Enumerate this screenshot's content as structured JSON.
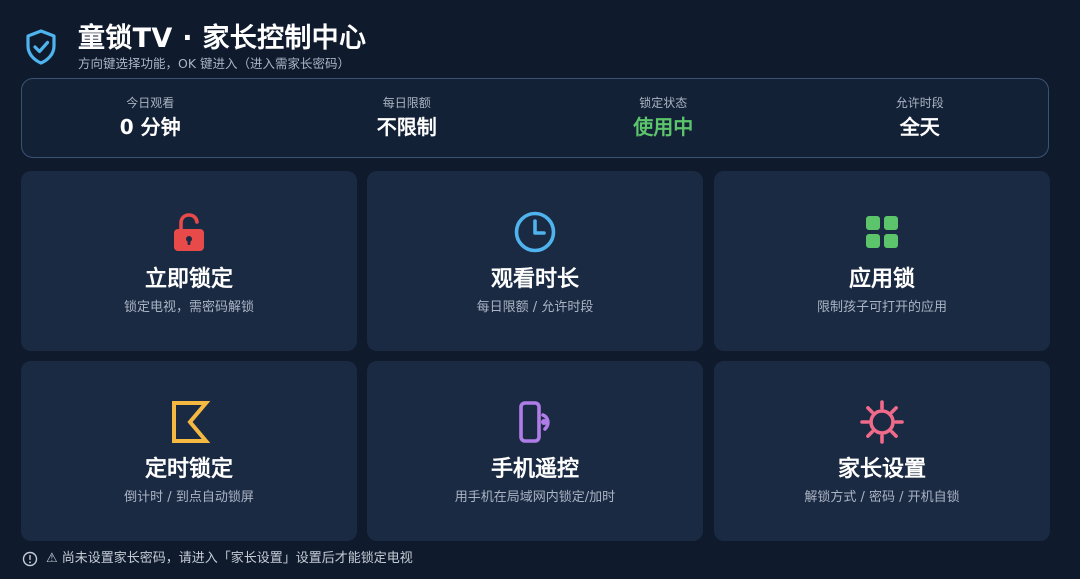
{
  "header": {
    "title": "童锁TV · 家长控制中心",
    "subtitle": "方向键选择功能，OK 键进入（进入需家长密码）",
    "icon": "shield-check-icon"
  },
  "stats": [
    {
      "label": "今日观看",
      "value": "0 分钟"
    },
    {
      "label": "每日限额",
      "value": "不限制"
    },
    {
      "label": "锁定状态",
      "value": "使用中"
    },
    {
      "label": "允许时段",
      "value": "全天"
    }
  ],
  "tiles": [
    {
      "title": "立即锁定",
      "desc": "锁定电视，需密码解锁",
      "icon": "padlock-icon",
      "color": "#e84a4a"
    },
    {
      "title": "观看时长",
      "desc": "每日限额 / 允许时段",
      "icon": "clock-icon",
      "color": "#4fb3ee"
    },
    {
      "title": "应用锁",
      "desc": "限制孩子可打开的应用",
      "icon": "app-grid-icon",
      "color": "#5cc46b"
    },
    {
      "title": "定时锁定",
      "desc": "倒计时 / 到点自动锁屏",
      "icon": "hourglass-icon",
      "color": "#f5b942"
    },
    {
      "title": "手机遥控",
      "desc": "用手机在局域网内锁定/加时",
      "icon": "phone-remote-icon",
      "color": "#b07de8"
    },
    {
      "title": "家长设置",
      "desc": "解锁方式 / 密码 / 开机自锁",
      "icon": "gear-icon",
      "color": "#f06a8a"
    }
  ],
  "footer": {
    "text": "⚠ 尚未设置家长密码，请进入「家长设置」设置后才能锁定电视"
  },
  "colors": {
    "background": "#0f1b2d",
    "tile": "#1b2a43",
    "accent_blue": "#4fb3ee",
    "status_active": "#5cc46b"
  }
}
